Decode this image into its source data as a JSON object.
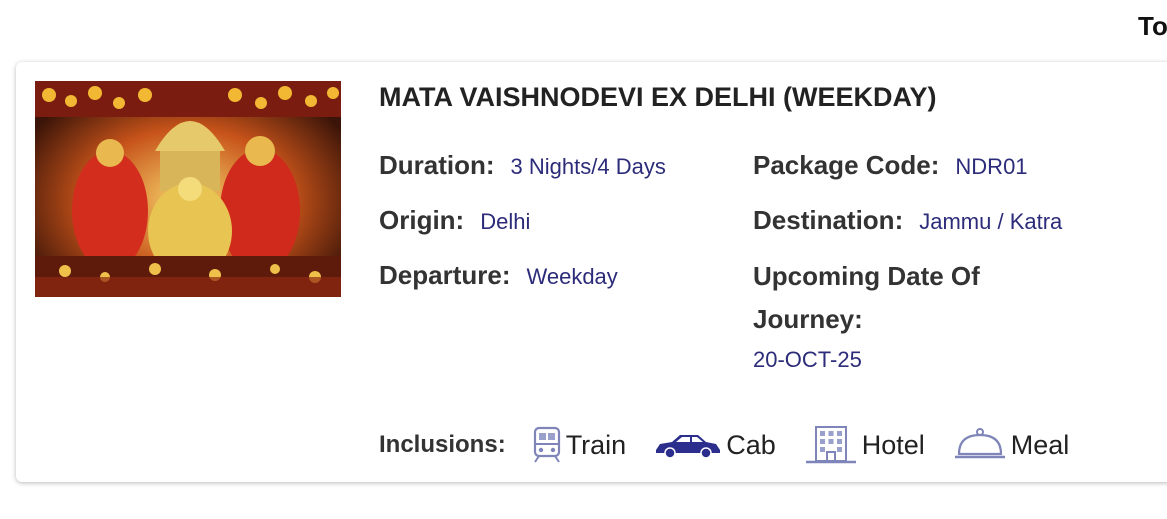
{
  "page": {
    "partial_header_text": "To"
  },
  "package": {
    "title": "MATA VAISHNODEVI EX DELHI (WEEKDAY)",
    "image_alt": "Mata Vaishnodevi shrine",
    "details": {
      "duration_label": "Duration:",
      "duration_value": "3 Nights/4 Days",
      "package_code_label": "Package Code:",
      "package_code_value": "NDR01",
      "origin_label": "Origin:",
      "origin_value": "Delhi",
      "destination_label": "Destination:",
      "destination_value": "Jammu / Katra",
      "departure_label": "Departure:",
      "departure_value": "Weekday",
      "upcoming_label": "Upcoming Date Of Journey:",
      "upcoming_value": "20-OCT-25"
    },
    "inclusions_label": "Inclusions:",
    "inclusions": [
      {
        "icon": "train-icon",
        "label": "Train"
      },
      {
        "icon": "cab-icon",
        "label": "Cab"
      },
      {
        "icon": "hotel-icon",
        "label": "Hotel"
      },
      {
        "icon": "meal-icon",
        "label": "Meal"
      }
    ]
  },
  "colors": {
    "value_text": "#2c2c7a",
    "icon_accent": "#2b2e8c",
    "icon_muted": "#7f85b8"
  }
}
